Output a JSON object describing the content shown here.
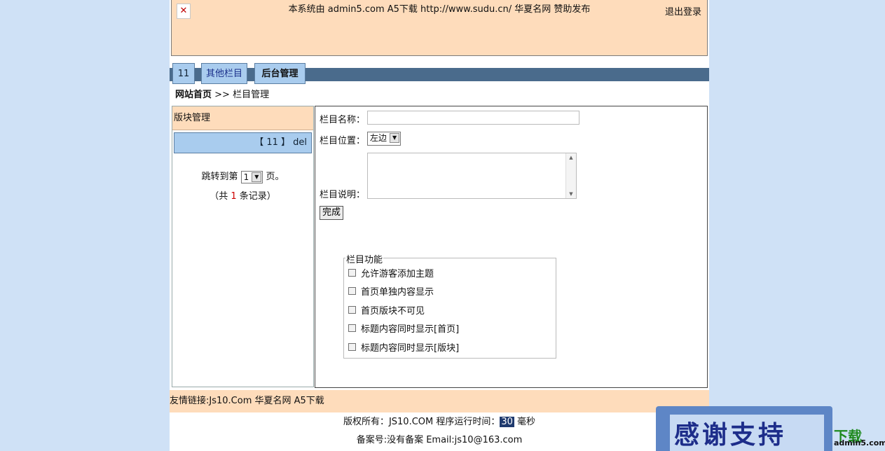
{
  "header": {
    "close_glyph": "✕",
    "notice": "本系统由 admin5.com A5下载 http://www.sudu.cn/ 华夏名网 赞助发布",
    "logout": "退出登录"
  },
  "nav": {
    "tabs": [
      {
        "label": "11"
      },
      {
        "label": "其他栏目"
      },
      {
        "label": "后台管理"
      }
    ]
  },
  "breadcrumb": {
    "home": "网站首页",
    "separator": ">>",
    "current": "栏目管理"
  },
  "left_panel": {
    "title": "版块管理",
    "row_label": "【 11 】 del",
    "jump_prefix": "跳转到第",
    "jump_value": "1",
    "jump_suffix": "页。",
    "count_prefix": "（共",
    "count_value": "1",
    "count_suffix": "条记录）"
  },
  "form": {
    "name_label": "栏目名称：",
    "name_value": "",
    "position_label": "栏目位置：",
    "position_value": "左边",
    "desc_label": "栏目说明：",
    "desc_value": "",
    "submit_label": "完成",
    "features_legend": "栏目功能",
    "options": [
      {
        "label": "允许游客添加主题",
        "checked": false
      },
      {
        "label": "首页单独内容显示",
        "checked": false
      },
      {
        "label": "首页版块不可见",
        "checked": false
      },
      {
        "label": "标题内容同时显示[首页]",
        "checked": false
      },
      {
        "label": "标题内容同时显示[版块]",
        "checked": false
      }
    ]
  },
  "footer": {
    "links": "友情链接:Js10.Com 华夏名网 A5下载",
    "copyright_prefix": "版权所有：JS10.COM 程序运行时间：",
    "runtime": "30",
    "runtime_unit": "毫秒",
    "icp": "备案号:没有备案 Email:js10@163.com"
  },
  "watermark": {
    "text": "感谢支持",
    "green": "下载",
    "url": "admin5.com"
  },
  "colors": {
    "background": "#cfe1f6",
    "header_bg": "#fedcbb",
    "nav_bar": "#4a6b8c",
    "tab_bg": "#a9ccee"
  }
}
